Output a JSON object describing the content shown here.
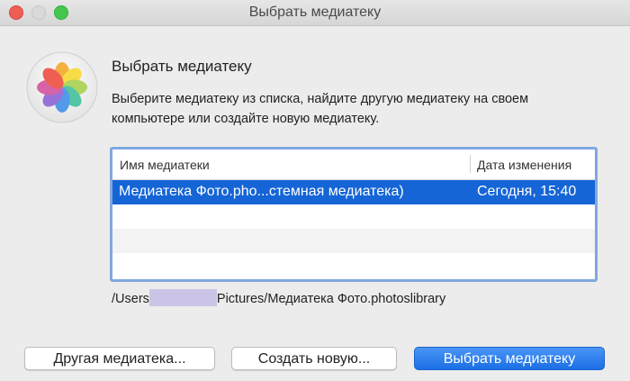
{
  "window": {
    "title": "Выбрать медиатеку"
  },
  "dialog": {
    "heading": "Выбрать медиатеку",
    "description": "Выберите медиатеку из списка, найдите другую медиатеку на своем компьютере или создайте новую медиатеку.",
    "app_icon": "photos-app-icon"
  },
  "table": {
    "columns": [
      "Имя медиатеки",
      "Дата изменения"
    ],
    "rows": [
      {
        "name": "Медиатека Фото.pho...стемная медиатека)",
        "date": "Сегодня, 15:40",
        "selected": true
      }
    ]
  },
  "path": {
    "prefix": "/Users",
    "suffix": "Pictures/Медиатека Фото.photoslibrary"
  },
  "buttons": {
    "other": "Другая медиатека...",
    "create": "Создать новую...",
    "choose": "Выбрать медиатеку"
  },
  "colors": {
    "selection": "#1565d6",
    "primary_button": "#1b6fe6",
    "close": "#ee5e55",
    "zoom": "#44c74c"
  }
}
